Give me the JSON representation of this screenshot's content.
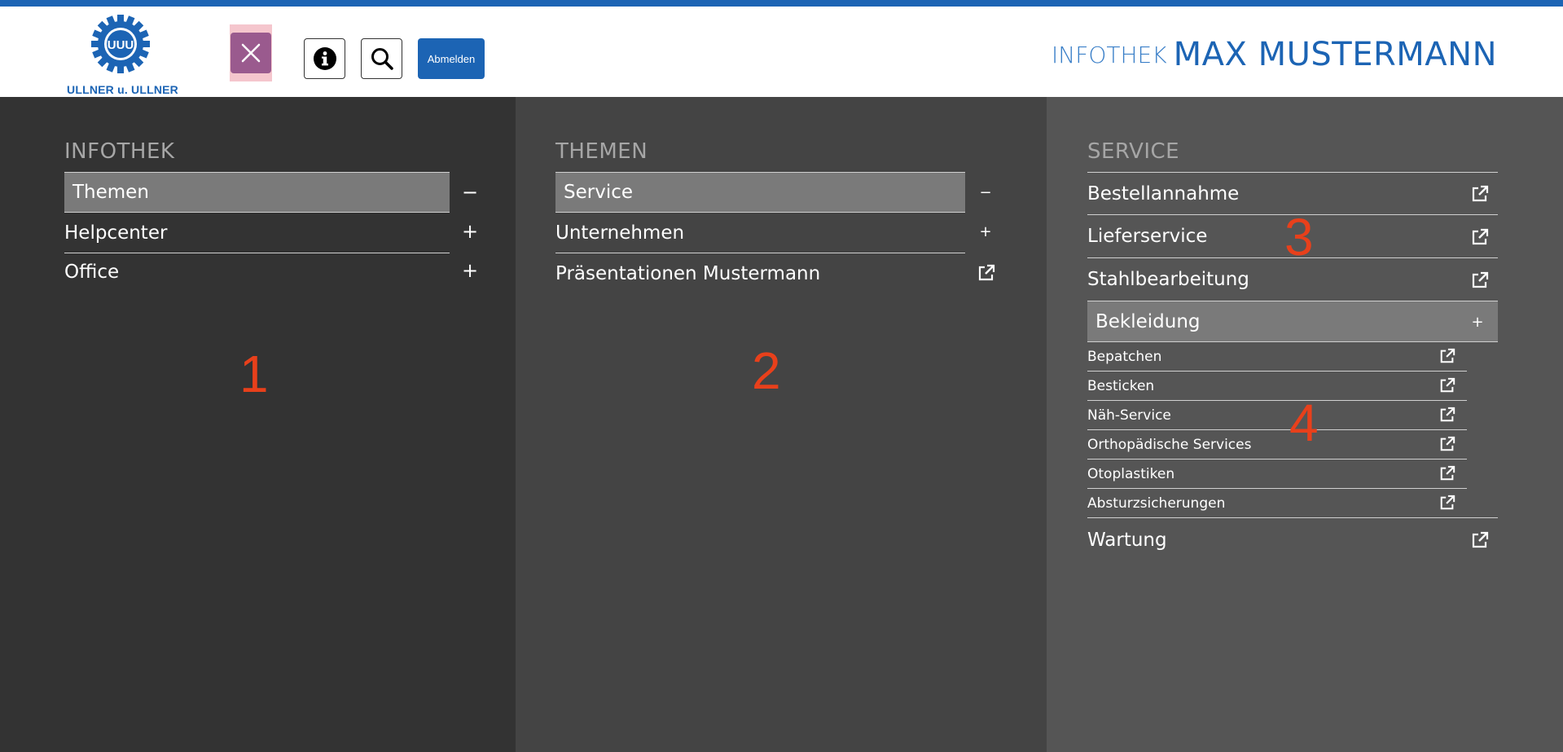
{
  "header": {
    "logo": {
      "wordmark": "ULLNER u. ULLNER",
      "gear_text": "UUU"
    },
    "close_icon": "close-icon",
    "info_icon": "info-icon",
    "search_icon": "search-icon",
    "logout_label": "Abmelden",
    "title_small": "INFOTHEK",
    "title_big": "MAX MUSTERMANN"
  },
  "colors": {
    "brand_blue": "#1c64b4",
    "close_button": "#9a5a8e",
    "close_highlight": "#f5c6cd",
    "active_item": "#7a7a7a",
    "annotation": "#e8401b"
  },
  "columns": {
    "infothek": {
      "title": "INFOTHEK",
      "items": [
        {
          "label": "Themen",
          "toggle": "−"
        },
        {
          "label": "Helpcenter",
          "toggle": "+"
        },
        {
          "label": "Office",
          "toggle": "+"
        }
      ],
      "marker": "1"
    },
    "themen": {
      "title": "THEMEN",
      "items": [
        {
          "label": "Service",
          "toggle": "−"
        },
        {
          "label": "Unternehmen",
          "toggle": "+"
        },
        {
          "label": "Präsentationen Mustermann",
          "icon": "external-link-icon"
        }
      ],
      "marker": "2"
    },
    "service": {
      "title": "SERVICE",
      "items": [
        {
          "label": "Bestellannahme",
          "icon": "external-link-icon"
        },
        {
          "label": "Lieferservice",
          "icon": "external-link-icon"
        },
        {
          "label": "Stahlbearbeitung",
          "icon": "external-link-icon"
        },
        {
          "label": "Bekleidung",
          "toggle": "+"
        },
        {
          "label": "Wartung",
          "icon": "external-link-icon"
        }
      ],
      "subitems": [
        {
          "label": "Bepatchen",
          "icon": "external-link-icon"
        },
        {
          "label": "Besticken",
          "icon": "external-link-icon"
        },
        {
          "label": "Näh-Service",
          "icon": "external-link-icon"
        },
        {
          "label": "Orthopädische Services",
          "icon": "external-link-icon"
        },
        {
          "label": "Otoplastiken",
          "icon": "external-link-icon"
        },
        {
          "label": "Absturzsicherungen",
          "icon": "external-link-icon"
        }
      ],
      "marker_main": "3",
      "marker_sub": "4"
    }
  }
}
